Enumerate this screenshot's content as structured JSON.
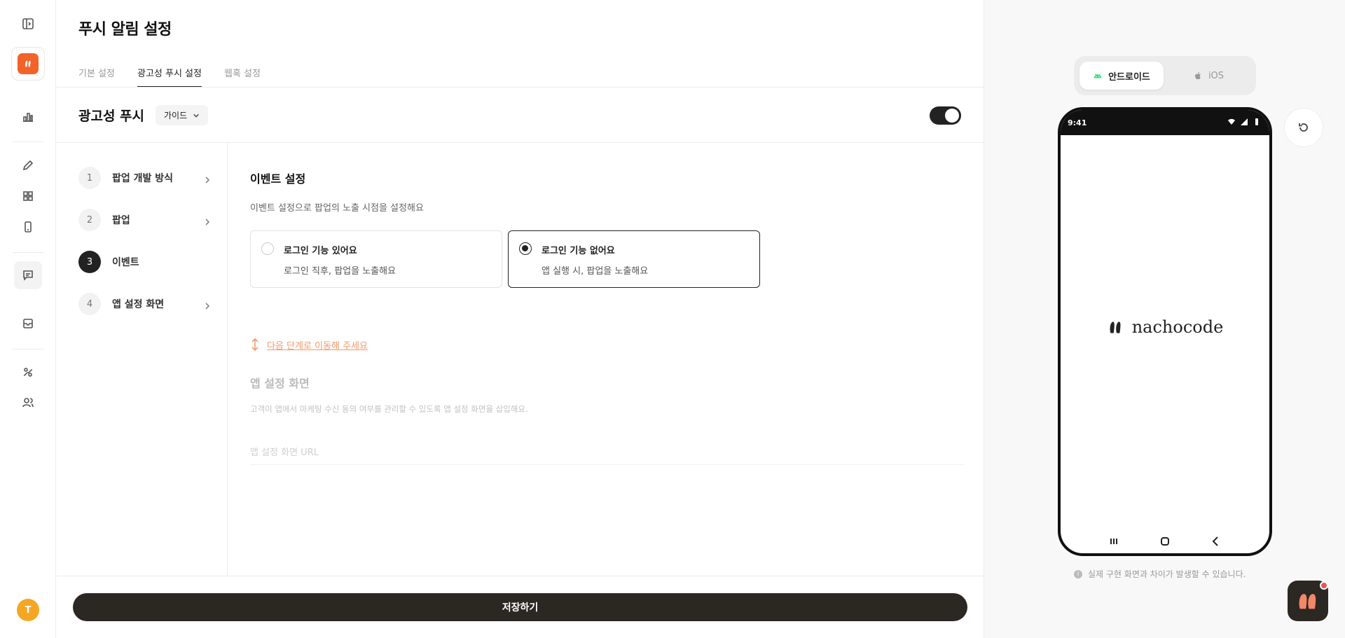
{
  "page": {
    "title": "푸시 알림 설정"
  },
  "tabs": [
    {
      "label": "기본 설정",
      "active": false
    },
    {
      "label": "광고성 푸시 설정",
      "active": true
    },
    {
      "label": "웹훅 설정",
      "active": false
    }
  ],
  "section": {
    "title": "광고성 푸시",
    "guide_label": "가이드",
    "toggle_on": true
  },
  "steps": [
    {
      "num": "1",
      "label": "팝업 개발 방식"
    },
    {
      "num": "2",
      "label": "팝업"
    },
    {
      "num": "3",
      "label": "이벤트",
      "active": true
    },
    {
      "num": "4",
      "label": "앱 설정 화면"
    }
  ],
  "content": {
    "title": "이벤트 설정",
    "desc": "이벤트 설정으로 팝업의 노출 시점을 설정해요",
    "options": [
      {
        "title": "로그인 기능 있어요",
        "sub": "로그인 직후, 팝업을 노출해요",
        "selected": false
      },
      {
        "title": "로그인 기능 없어요",
        "sub": "앱 실행 시, 팝업을 노출해요",
        "selected": true
      }
    ],
    "next_link": "다음 단계로 이동해 주세요",
    "next_title": "앱 설정 화면",
    "next_desc": "고객이 앱에서 마케팅 수신 동의 여부를 관리할 수 있도록 앱 설정 화면을 삽입해요.",
    "url_placeholder": "앱 설정 화면 URL"
  },
  "save_label": "저장하기",
  "preview": {
    "os_options": [
      {
        "label": "안드로이드",
        "active": true,
        "icon": "android-icon"
      },
      {
        "label": "iOS",
        "active": false,
        "icon": "apple-icon"
      }
    ],
    "status_time": "9:41",
    "brand": "nachocode",
    "notice": "실제 구현 화면과 차이가 발생할 수 있습니다."
  },
  "user": {
    "avatar_letter": "T"
  },
  "colors": {
    "brand": "#f2632a",
    "dark": "#2b2722",
    "link": "#f59a6a"
  }
}
